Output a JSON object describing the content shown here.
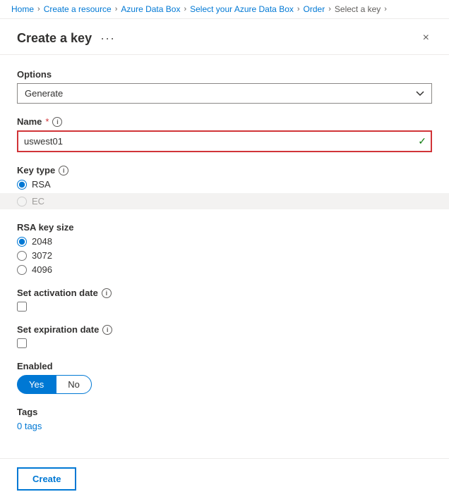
{
  "breadcrumb": {
    "items": [
      "Home",
      "Create a resource",
      "Azure Data Box",
      "Select your Azure Data Box",
      "Order",
      "Select a key"
    ]
  },
  "panel": {
    "title": "Create a key",
    "menu_dots": "···",
    "close_label": "×"
  },
  "form": {
    "options_label": "Options",
    "options_value": "Generate",
    "options_placeholder": "Generate",
    "name_label": "Name",
    "name_required": "*",
    "name_value": "uswest01",
    "key_type_label": "Key type",
    "rsa_label": "RSA",
    "ec_label": "EC",
    "rsa_key_size_label": "RSA key size",
    "rsa_sizes": [
      "2048",
      "3072",
      "4096"
    ],
    "activation_date_label": "Set activation date",
    "expiration_date_label": "Set expiration date",
    "enabled_label": "Enabled",
    "yes_label": "Yes",
    "no_label": "No",
    "tags_label": "Tags",
    "tags_count": "0 tags"
  },
  "footer": {
    "create_label": "Create"
  }
}
